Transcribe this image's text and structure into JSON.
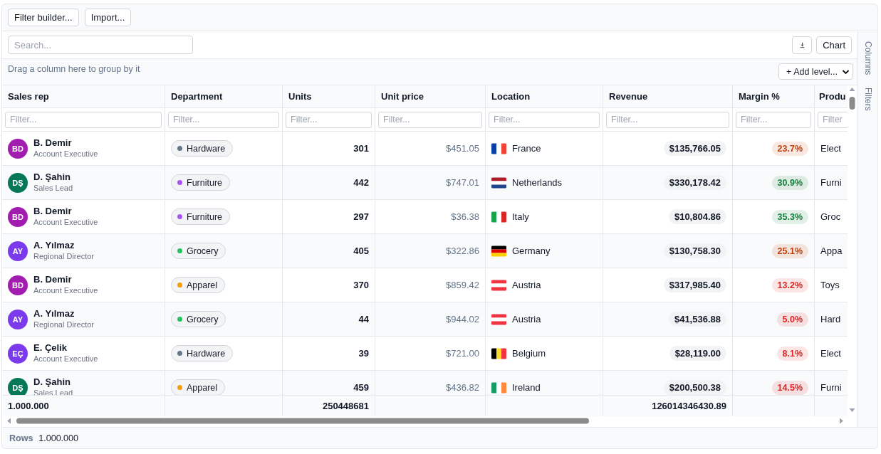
{
  "toolbar": {
    "buttons": [
      "Filter builder...",
      "Import..."
    ]
  },
  "search": {
    "placeholder": "Search..."
  },
  "chart_button": "Chart",
  "group_panel": {
    "hint": "Drag a column here to group by it",
    "add_level": "+ Add level..."
  },
  "table": {
    "columns": [
      "Sales rep",
      "Department",
      "Units",
      "Unit price",
      "Location",
      "Revenue",
      "Margin %",
      "Produ"
    ],
    "filters": [
      {
        "placeholder": "Filter..."
      },
      {
        "placeholder": "Filter..."
      },
      {
        "placeholder": "Filter..."
      },
      {
        "placeholder": "Filter..."
      },
      {
        "placeholder": "Filter..."
      },
      {
        "placeholder": "Filter..."
      },
      {
        "placeholder": "Filter..."
      },
      {
        "placeholder": "Filter"
      }
    ],
    "rows": [
      {
        "rep": {
          "initials": "BD",
          "color": "#a21caf",
          "name": "B. Demir",
          "title": "Account Executive"
        },
        "department": {
          "label": "Hardware",
          "color": "#64748b"
        },
        "units": "301",
        "unit_price": "$451.05",
        "location": {
          "name": "France",
          "flag": {
            "kind": "vertical",
            "stripes": [
              {
                "color": "#0b3fa8"
              },
              {
                "color": "#ffffff"
              },
              {
                "color": "#ef4135"
              }
            ]
          }
        },
        "revenue": "$135,766.05",
        "margin": {
          "text": "23.7%",
          "color": "#c2410c"
        },
        "column_8": "Elect"
      },
      {
        "rep": {
          "initials": "DŞ",
          "color": "#047857",
          "name": "D. Şahin",
          "title": "Sales Lead"
        },
        "department": {
          "label": "Furniture",
          "color": "#a855f7"
        },
        "units": "442",
        "unit_price": "$747.01",
        "location": {
          "name": "Netherlands",
          "flag": {
            "kind": "horizontal",
            "stripes": [
              {
                "color": "#ae1c28"
              },
              {
                "color": "#ffffff"
              },
              {
                "color": "#21468b"
              }
            ]
          }
        },
        "revenue": "$330,178.42",
        "margin": {
          "text": "30.9%",
          "color": "#15803d"
        },
        "column_8": "Furni"
      },
      {
        "rep": {
          "initials": "BD",
          "color": "#a21caf",
          "name": "B. Demir",
          "title": "Account Executive"
        },
        "department": {
          "label": "Furniture",
          "color": "#a855f7"
        },
        "units": "297",
        "unit_price": "$36.38",
        "location": {
          "name": "Italy",
          "flag": {
            "kind": "vertical",
            "stripes": [
              {
                "color": "#16a34a"
              },
              {
                "color": "#ffffff"
              },
              {
                "color": "#dc2626"
              }
            ]
          }
        },
        "revenue": "$10,804.86",
        "margin": {
          "text": "35.3%",
          "color": "#15803d"
        },
        "column_8": "Groc"
      },
      {
        "rep": {
          "initials": "AY",
          "color": "#7c3aed",
          "name": "A. Yılmaz",
          "title": "Regional Director"
        },
        "department": {
          "label": "Grocery",
          "color": "#22c55e"
        },
        "units": "405",
        "unit_price": "$322.86",
        "location": {
          "name": "Germany",
          "flag": {
            "kind": "horizontal",
            "stripes": [
              {
                "color": "#000000"
              },
              {
                "color": "#dd0000"
              },
              {
                "color": "#ffce00"
              }
            ]
          }
        },
        "revenue": "$130,758.30",
        "margin": {
          "text": "25.1%",
          "color": "#c2410c"
        },
        "column_8": "Appa"
      },
      {
        "rep": {
          "initials": "BD",
          "color": "#a21caf",
          "name": "B. Demir",
          "title": "Account Executive"
        },
        "department": {
          "label": "Apparel",
          "color": "#f59e0b"
        },
        "units": "370",
        "unit_price": "$859.42",
        "location": {
          "name": "Austria",
          "flag": {
            "kind": "horizontal",
            "stripes": [
              {
                "color": "#ef3340"
              },
              {
                "color": "#ffffff"
              },
              {
                "color": "#ef3340"
              }
            ]
          }
        },
        "revenue": "$317,985.40",
        "margin": {
          "text": "13.2%",
          "color": "#dc2626"
        },
        "column_8": "Toys"
      },
      {
        "rep": {
          "initials": "AY",
          "color": "#7c3aed",
          "name": "A. Yılmaz",
          "title": "Regional Director"
        },
        "department": {
          "label": "Grocery",
          "color": "#22c55e"
        },
        "units": "44",
        "unit_price": "$944.02",
        "location": {
          "name": "Austria",
          "flag": {
            "kind": "horizontal",
            "stripes": [
              {
                "color": "#ef3340"
              },
              {
                "color": "#ffffff"
              },
              {
                "color": "#ef3340"
              }
            ]
          }
        },
        "revenue": "$41,536.88",
        "margin": {
          "text": "5.0%",
          "color": "#dc2626"
        },
        "column_8": "Hard"
      },
      {
        "rep": {
          "initials": "EÇ",
          "color": "#7c3aed",
          "name": "E. Çelik",
          "title": "Account Executive"
        },
        "department": {
          "label": "Hardware",
          "color": "#64748b"
        },
        "units": "39",
        "unit_price": "$721.00",
        "location": {
          "name": "Belgium",
          "flag": {
            "kind": "vertical",
            "stripes": [
              {
                "color": "#000000"
              },
              {
                "color": "#fdda24"
              },
              {
                "color": "#ef3340"
              }
            ]
          }
        },
        "revenue": "$28,119.00",
        "margin": {
          "text": "8.1%",
          "color": "#dc2626"
        },
        "column_8": "Elect"
      },
      {
        "rep": {
          "initials": "DŞ",
          "color": "#047857",
          "name": "D. Şahin",
          "title": "Sales Lead"
        },
        "department": {
          "label": "Apparel",
          "color": "#f59e0b"
        },
        "units": "459",
        "unit_price": "$436.82",
        "location": {
          "name": "Ireland",
          "flag": {
            "kind": "vertical",
            "stripes": [
              {
                "color": "#169b62"
              },
              {
                "color": "#ffffff"
              },
              {
                "color": "#ff883e"
              }
            ]
          }
        },
        "revenue": "$200,500.38",
        "margin": {
          "text": "14.5%",
          "color": "#dc2626"
        },
        "column_8": "Furni"
      }
    ],
    "footer": {
      "sales_rep": "1.000.000",
      "units": "250448681",
      "revenue": "126014346430.89"
    }
  },
  "side_tabs": [
    "Columns",
    "Filters"
  ],
  "status_bar": {
    "label": "Rows",
    "value": "1.000.000"
  }
}
